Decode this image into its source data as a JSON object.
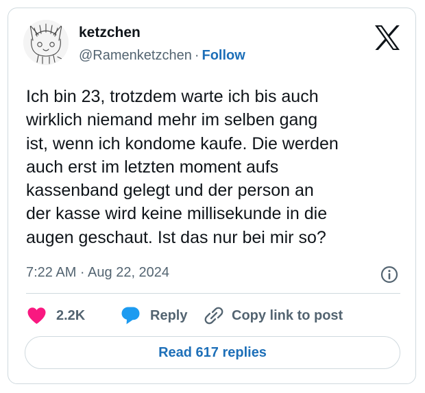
{
  "author": {
    "display_name": "ketzchen",
    "handle": "@Ramenketzchen",
    "separator": "·",
    "follow_label": "Follow"
  },
  "tweet": {
    "lines": [
      "Ich bin 23, trotzdem warte ich bis auch",
      "wirklich niemand mehr im selben gang",
      "ist, wenn ich kondome kaufe. Die werden",
      "auch erst im letzten moment aufs",
      "kassenband gelegt und der person an",
      "der kasse wird keine millisekunde in die",
      "augen geschaut. Ist das nur bei mir so?"
    ],
    "timestamp": "7:22 AM · Aug 22, 2024"
  },
  "actions": {
    "like_count": "2.2K",
    "reply_label": "Reply",
    "copy_link_label": "Copy link to post"
  },
  "read_replies_label": "Read 617 replies",
  "icons": {
    "brand": "x-logo-icon",
    "info": "info-icon",
    "like": "heart-icon",
    "reply": "speech-bubble-icon",
    "copy": "link-icon"
  },
  "colors": {
    "like": "#f91880",
    "reply": "#1d9bf0",
    "link": "#1d6fb8",
    "secondary_text": "#536471",
    "border": "#cfd9de"
  }
}
